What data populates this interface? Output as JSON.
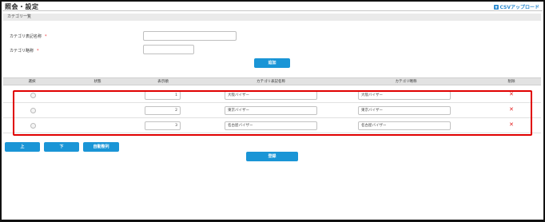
{
  "header": {
    "title": "照会・設定",
    "csv_upload_label": "CSVアップロード"
  },
  "section": {
    "title": "カテゴリ一覧"
  },
  "form": {
    "display_name_label": "カテゴリ表記名称",
    "short_name_label": "カテゴリ略称",
    "required_mark": "*",
    "display_name_value": "",
    "short_name_value": "",
    "add_button": "追加"
  },
  "table": {
    "columns": [
      "選択",
      "状態",
      "表示順",
      "カテゴリ表記名称",
      "カテゴリ略称",
      "削除"
    ],
    "rows": [
      {
        "status": "",
        "order": "1",
        "display_name": "大阪バイザー",
        "short_name": "大阪バイザー",
        "delete": "✕"
      },
      {
        "status": "",
        "order": "2",
        "display_name": "東京バイザー",
        "short_name": "東京バイザー",
        "delete": "✕"
      },
      {
        "status": "",
        "order": "3",
        "display_name": "名古屋バイザー",
        "short_name": "名古屋バイザー",
        "delete": "✕"
      }
    ]
  },
  "actions": {
    "up_button": "上",
    "down_button": "下",
    "auto_sort_button": "自動整列",
    "register_button": "登録"
  },
  "colors": {
    "accent": "#1a95d6",
    "highlight": "#e00000",
    "delete": "#e21b1b"
  }
}
